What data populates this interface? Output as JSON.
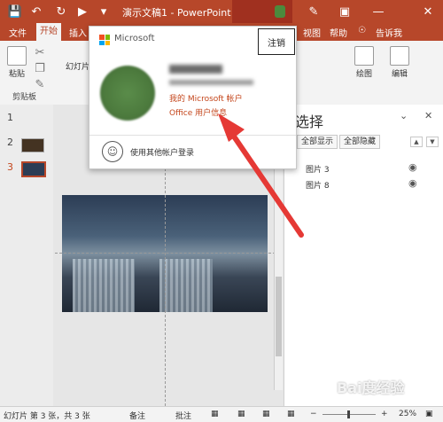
{
  "app": {
    "title": "演示文稿1 - PowerPoint",
    "accent_color": "#b7472a"
  },
  "tabs": [
    {
      "label": "文件"
    },
    {
      "label": "开始"
    },
    {
      "label": "插入"
    },
    {
      "label": "视图"
    },
    {
      "label": "帮助"
    },
    {
      "label": "告诉我"
    }
  ],
  "ribbon": {
    "paste_label": "粘贴",
    "clipboard_label": "剪贴板",
    "slide_label": "幻灯片",
    "drawing_label": "绘图",
    "edit_label": "编辑"
  },
  "thumbnails": [
    {
      "num": "1"
    },
    {
      "num": "2"
    },
    {
      "num": "3"
    }
  ],
  "popup": {
    "brand": "Microsoft",
    "signout": "注销",
    "link_account": "我的 Microsoft 帐户",
    "link_office": "Office 用户信息",
    "other_login": "使用其他帐户登录"
  },
  "selection_pane": {
    "title": "选择",
    "show_all": "全部显示",
    "hide_all": "全部隐藏",
    "items": [
      {
        "label": "图片 3"
      },
      {
        "label": "图片 8"
      }
    ]
  },
  "status": {
    "slide_info": "幻灯片 第 3 张，共 3 张",
    "notes": "备注",
    "comments": "批注",
    "zoom": "25%"
  },
  "watermark": {
    "text": "Bai度经验",
    "sub": "jingyan.baidu.com"
  }
}
